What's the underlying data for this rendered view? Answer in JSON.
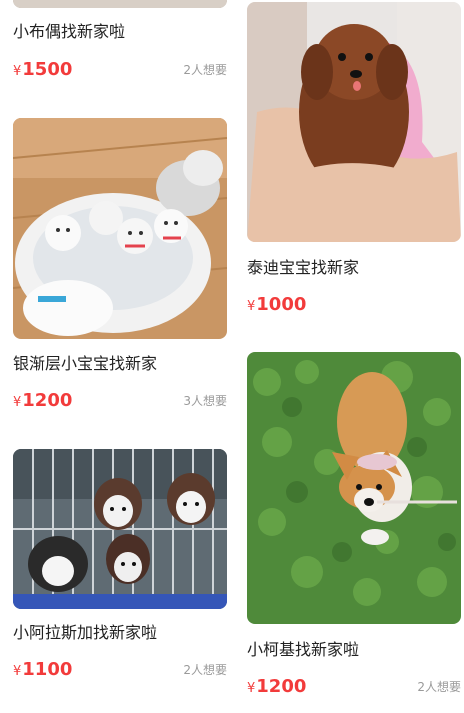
{
  "listings": [
    {
      "title": "小布偶找新家啦",
      "currency": "¥",
      "price": "1500",
      "want": "2人想要",
      "image": "ragdoll-kitten-photo"
    },
    {
      "title": "泰迪宝宝找新家",
      "currency": "¥",
      "price": "1000",
      "want": "",
      "image": "teddy-puppy-photo"
    },
    {
      "title": "银渐层小宝宝找新家",
      "currency": "¥",
      "price": "1200",
      "want": "3人想要",
      "image": "silver-shaded-kittens-photo"
    },
    {
      "title": "小柯基找新家啦",
      "currency": "¥",
      "price": "1200",
      "want": "2人想要",
      "image": "corgi-puppy-photo"
    },
    {
      "title": "小阿拉斯加找新家啦",
      "currency": "¥",
      "price": "1100",
      "want": "2人想要",
      "image": "alaskan-puppies-photo"
    }
  ],
  "colors": {
    "price": "#f23b3b",
    "want": "#9a9a9a",
    "title": "#222222"
  }
}
